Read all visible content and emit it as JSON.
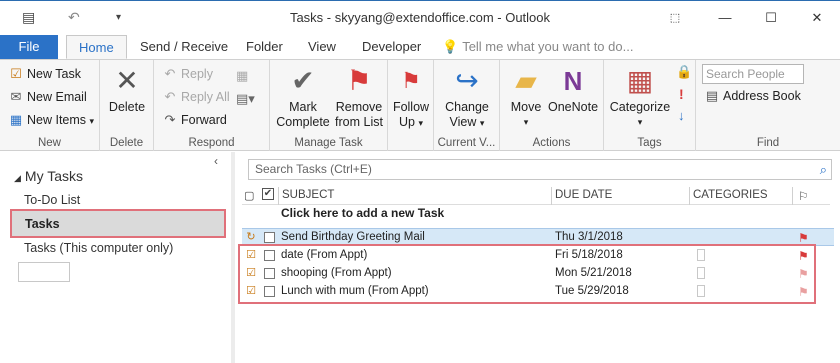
{
  "window": {
    "title": "Tasks - skyyang@extendoffice.com - Outlook",
    "qat": {
      "save_icon": "outlook-app-icon",
      "undo_icon": "undo-icon",
      "customize_icon": "customize-qat-icon"
    },
    "controls": {
      "restore_ribbon": "ribbon-display-icon",
      "minimize": "—",
      "maximize": "☐",
      "close": "✕"
    }
  },
  "ribbon_tabs": {
    "file": "File",
    "home": "Home",
    "send_receive": "Send / Receive",
    "folder": "Folder",
    "view": "View",
    "developer": "Developer",
    "tell_me": "Tell me what you want to do..."
  },
  "ribbon": {
    "new": {
      "new_task": "New Task",
      "new_email": "New Email",
      "new_items": "New Items",
      "label": "New"
    },
    "delete": {
      "delete": "Delete",
      "label": "Delete"
    },
    "respond": {
      "reply": "Reply",
      "reply_all": "Reply All",
      "forward": "Forward",
      "label": "Respond"
    },
    "manage_task": {
      "mark_complete_1": "Mark",
      "mark_complete_2": "Complete",
      "remove_1": "Remove",
      "remove_2": "from List",
      "label": "Manage Task"
    },
    "follow_up": {
      "line1": "Follow",
      "line2": "Up",
      "label": ""
    },
    "current_view": {
      "line1": "Change",
      "line2": "View",
      "label": "Current V..."
    },
    "actions": {
      "move": "Move",
      "onenote": "OneNote",
      "label": "Actions"
    },
    "tags": {
      "categorize": "Categorize",
      "label": "Tags"
    },
    "find": {
      "search_people_placeholder": "Search People",
      "address_book": "Address Book",
      "label": "Find"
    }
  },
  "nav": {
    "header": "My Tasks",
    "items": [
      {
        "label": "To-Do List"
      },
      {
        "label": "Tasks"
      },
      {
        "label": "Tasks (This computer only)"
      }
    ]
  },
  "main": {
    "search_placeholder": "Search Tasks (Ctrl+E)",
    "columns": {
      "subject": "SUBJECT",
      "due_date": "DUE DATE",
      "categories": "CATEGORIES"
    },
    "add_new": "Click here to add a new Task",
    "rows": [
      {
        "subject": "Send Birthday Greeting Mail",
        "due": "Thu 3/1/2018",
        "flag": "red"
      },
      {
        "subject": "date (From Appt)",
        "due": "Fri 5/18/2018",
        "flag": "red"
      },
      {
        "subject": "shooping (From Appt)",
        "due": "Mon 5/21/2018",
        "flag": "pink"
      },
      {
        "subject": "Lunch with mum (From Appt)",
        "due": "Tue 5/29/2018",
        "flag": "pink"
      }
    ]
  },
  "colors": {
    "accent": "#2b72c7",
    "highlight": "#e0707a",
    "selected_row": "#d6e8f7",
    "flag": "#d83b3b"
  }
}
